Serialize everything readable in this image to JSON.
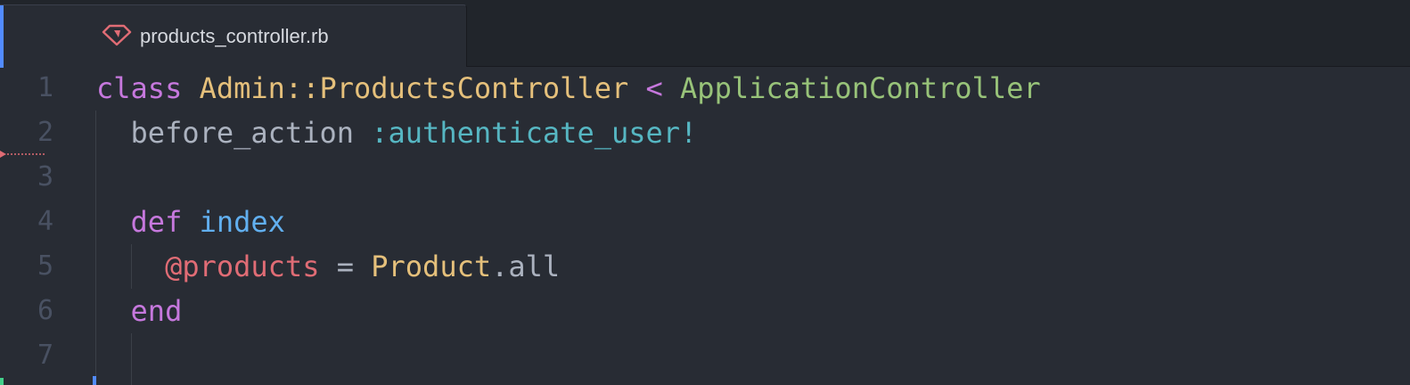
{
  "tab": {
    "title": "products_controller.rb",
    "icon": "ruby-icon"
  },
  "editor": {
    "line_numbers": [
      "1",
      "2",
      "3",
      "4",
      "5",
      "6",
      "7"
    ],
    "lines": [
      {
        "tokens": [
          {
            "t": "class",
            "c": "kw"
          },
          {
            "t": " ",
            "c": "plain"
          },
          {
            "t": "Admin::ProductsController",
            "c": "cls"
          },
          {
            "t": " < ",
            "c": "kw"
          },
          {
            "t": "ApplicationController",
            "c": "inh"
          }
        ]
      },
      {
        "tokens": [
          {
            "t": "  before_action ",
            "c": "plain"
          },
          {
            "t": ":authenticate_user!",
            "c": "sym"
          }
        ]
      },
      {
        "tokens": []
      },
      {
        "tokens": [
          {
            "t": "  ",
            "c": "plain"
          },
          {
            "t": "def",
            "c": "kw"
          },
          {
            "t": " ",
            "c": "plain"
          },
          {
            "t": "index",
            "c": "fn"
          }
        ]
      },
      {
        "tokens": [
          {
            "t": "    ",
            "c": "plain"
          },
          {
            "t": "@products",
            "c": "ivar"
          },
          {
            "t": " = ",
            "c": "plain"
          },
          {
            "t": "Product",
            "c": "cls"
          },
          {
            "t": ".all",
            "c": "plain"
          }
        ]
      },
      {
        "tokens": [
          {
            "t": "  ",
            "c": "plain"
          },
          {
            "t": "end",
            "c": "kw"
          }
        ]
      },
      {
        "tokens": []
      }
    ]
  },
  "colors": {
    "background": "#282c34",
    "keyword": "#c678dd",
    "class": "#e5c07b",
    "superclass": "#98c379",
    "function": "#61afef",
    "symbol": "#56b6c2",
    "ivar": "#e06c75",
    "line_number": "#495162"
  }
}
